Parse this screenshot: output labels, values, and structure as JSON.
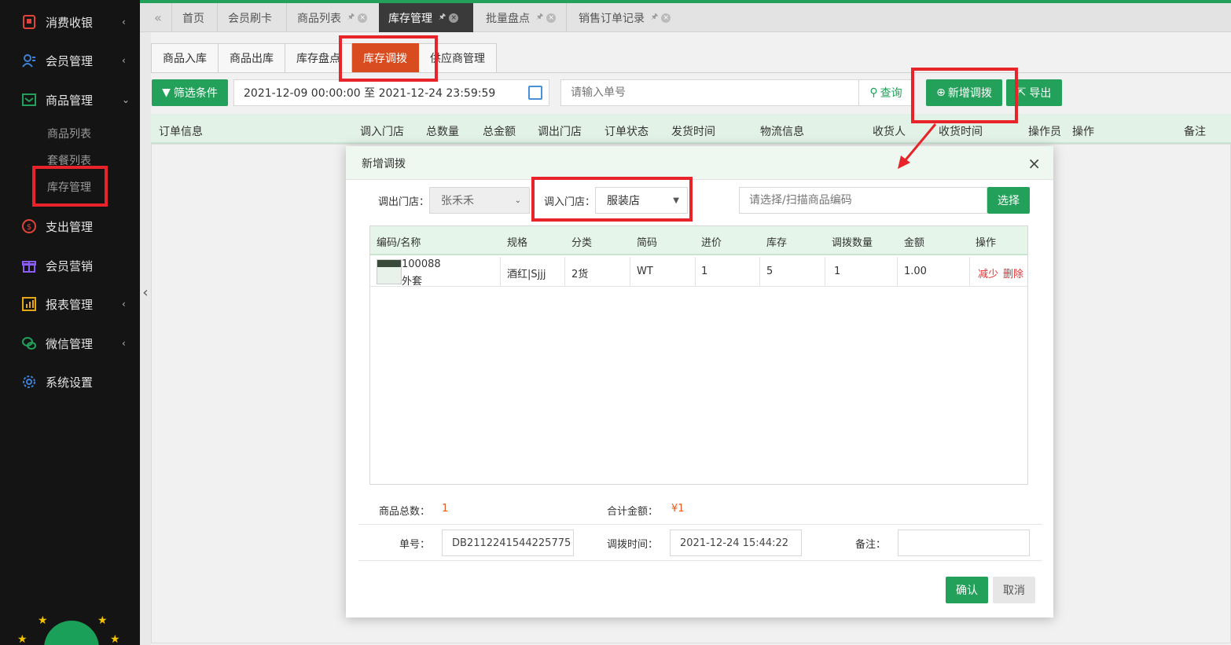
{
  "sidebar": {
    "items": [
      {
        "label": "消费收银",
        "icon": "cash-register-icon",
        "arrow": "‹"
      },
      {
        "label": "会员管理",
        "icon": "members-icon",
        "arrow": "‹"
      },
      {
        "label": "商品管理",
        "icon": "goods-icon",
        "arrow": "⌄"
      },
      {
        "label": "支出管理",
        "icon": "expense-icon",
        "arrow": ""
      },
      {
        "label": "会员营销",
        "icon": "gift-icon",
        "arrow": ""
      },
      {
        "label": "报表管理",
        "icon": "report-icon",
        "arrow": "‹"
      },
      {
        "label": "微信管理",
        "icon": "wechat-icon",
        "arrow": "‹"
      },
      {
        "label": "系统设置",
        "icon": "gear-icon",
        "arrow": ""
      }
    ],
    "subitems": [
      "商品列表",
      "套餐列表",
      "库存管理"
    ]
  },
  "tabs": [
    {
      "label": "首页"
    },
    {
      "label": "会员刷卡"
    },
    {
      "label": "商品列表"
    },
    {
      "label": "库存管理"
    },
    {
      "label": "批量盘点"
    },
    {
      "label": "销售订单记录"
    }
  ],
  "subtabs": [
    "商品入库",
    "商品出库",
    "库存盘点",
    "库存调拨",
    "供应商管理"
  ],
  "toolbar": {
    "filter_label": "筛选条件",
    "date_range": "2021-12-09 00:00:00 至 2021-12-24 23:59:59",
    "order_placeholder": "请输入单号",
    "query_label": "查询",
    "add_label": "新增调拨",
    "export_label": "导出"
  },
  "grid": {
    "headers": [
      "订单信息",
      "调入门店",
      "总数量",
      "总金额",
      "调出门店",
      "订单状态",
      "发货时间",
      "物流信息",
      "收货人",
      "收货时间",
      "操作员",
      "操作",
      "备注"
    ]
  },
  "modal": {
    "title": "新增调拨",
    "out_store_label": "调出门店：",
    "out_store_value": "张禾禾",
    "in_store_label": "调入门店：",
    "in_store_value": "服装店",
    "scan_placeholder": "请选择/扫描商品编码",
    "choose_label": "选择",
    "table_headers": [
      "编码/名称",
      "规格",
      "分类",
      "简码",
      "进价",
      "库存",
      "调拨数量",
      "金额",
      "操作"
    ],
    "rows": [
      {
        "code": "100088",
        "name": "外套",
        "spec": "酒红|Sjjj",
        "category": "2货",
        "short_code": "WT",
        "cost": "1",
        "stock": "5",
        "qty": "1",
        "amount": "1.00",
        "reduce": "减少",
        "delete": "删除"
      }
    ],
    "total_count_label": "商品总数：",
    "total_count": "1",
    "total_amount_label": "合计金额：",
    "total_amount": "¥1",
    "order_no_label": "单号：",
    "order_no": "DB2112241544225775",
    "transfer_time_label": "调拨时间：",
    "transfer_time": "2021-12-24 15:44:22",
    "remark_label": "备注：",
    "remark": "",
    "confirm_label": "确认",
    "cancel_label": "取消"
  },
  "colors": {
    "brand_green": "#23a05a",
    "active_subtab": "#d94c1f",
    "annotation_red": "#e8232a",
    "sidebar_bg": "#141414"
  }
}
